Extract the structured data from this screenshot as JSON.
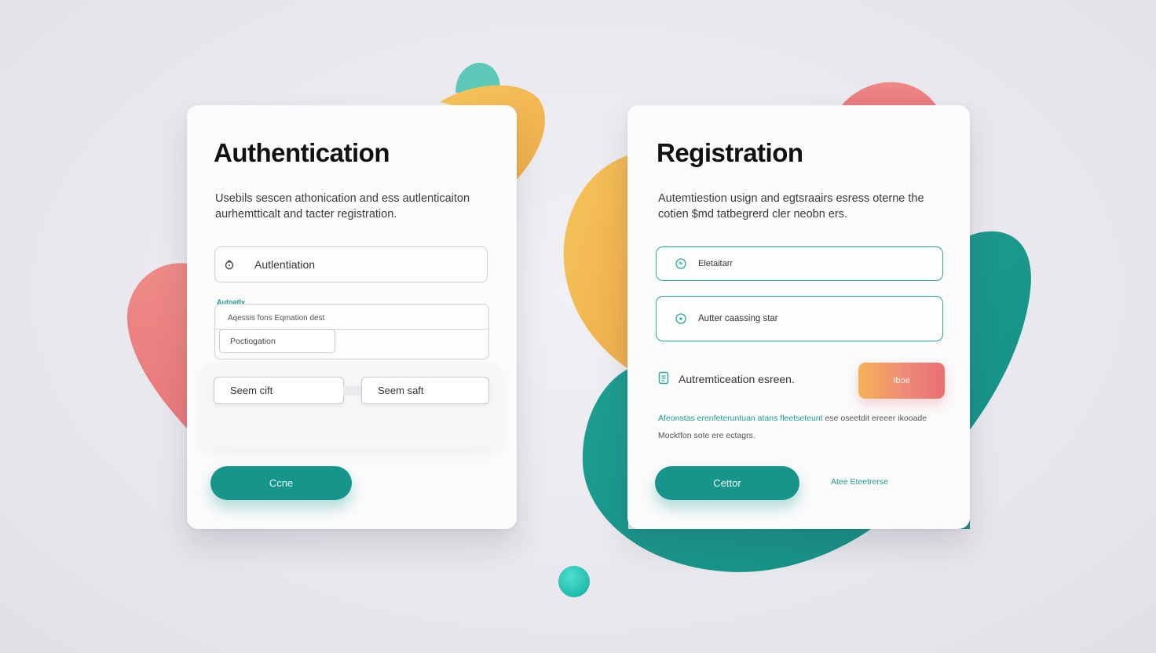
{
  "colors": {
    "teal": "#17958b",
    "teal_light": "#2aa59a",
    "coral": "#ea6f72",
    "amber": "#f4b256",
    "background": "#e8e8ee",
    "card": "#fbfbfc"
  },
  "auth": {
    "title": "Authentication",
    "description": "Usebils sescen athonication and ess autlenticaiton aurhemtticalt and tacter registration.",
    "field": {
      "icon": "lock-icon",
      "value": "Autlentiation"
    },
    "section_label": "Autoatly",
    "group": {
      "hint": "Aqessis fons Eqmation dest",
      "input_placeholder": "Poctiogation"
    },
    "segments": [
      "Seem cift",
      "Seem saft"
    ],
    "primary_button": "Ccne"
  },
  "registration": {
    "title": "Registration",
    "description": "Autemtiestion usign and egtsraairs esress oterne the cotien $md tatbegrerd cler neobn ers.",
    "fields": [
      {
        "icon": "clock-icon",
        "value": "Eletaitarr"
      },
      {
        "icon": "check-circle-icon",
        "value": "Autter caassing star"
      }
    ],
    "row": {
      "icon": "document-icon",
      "text": "Autremticeation esreen.",
      "button": "Iboe"
    },
    "note": {
      "accent": "Afeonstas erenfeteruntuan atans fleetseteunt",
      "rest": "ese oseetdit ereeer ikooade",
      "line2": "Mocktfon sote ere ectagrs."
    },
    "primary_button": "Cettor",
    "link": "Atee Eteetrerse"
  }
}
